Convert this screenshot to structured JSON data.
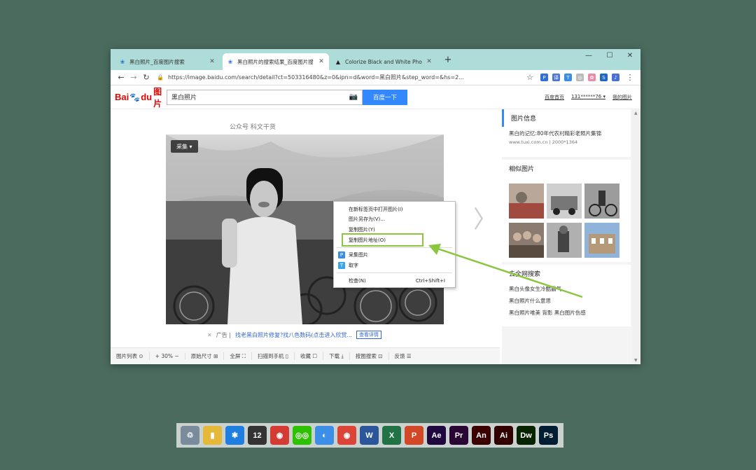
{
  "browser": {
    "tabs": [
      {
        "label": "黑白照片_百度图片搜索",
        "icon": "baidu-paw-icon"
      },
      {
        "label": "黑白照片的搜索结果_百度图片搜",
        "icon": "baidu-paw-icon"
      },
      {
        "label": "Colorize Black and White Pho",
        "icon": "algorithmia-icon"
      }
    ],
    "new_tab": "+",
    "controls": {
      "minimize": "—",
      "maximize": "☐",
      "close": "✕"
    },
    "url": "https://image.baidu.com/search/detail?ct=503316480&z=0&ipn=d&word=黑白照片&step_word=&hs=2...",
    "ext_icons": [
      {
        "name": "pocket-icon",
        "glyph": "P",
        "color": "#2f6fd8"
      },
      {
        "name": "translate-icon",
        "glyph": "译",
        "color": "#4a77d4"
      },
      {
        "name": "t-icon",
        "glyph": "T",
        "color": "#3a8ee6"
      },
      {
        "name": "circle-icon",
        "glyph": "◎",
        "color": "#bbbbbb"
      },
      {
        "name": "pink-icon",
        "glyph": "✿",
        "color": "#e88ca8"
      },
      {
        "name": "s-icon",
        "glyph": "S",
        "color": "#1f66c9"
      },
      {
        "name": "music-icon",
        "glyph": "♪",
        "color": "#4a6fd8"
      }
    ]
  },
  "baidu": {
    "logo": {
      "bai": "Bai",
      "paw": "🐾",
      "du": "du",
      "img": "图片"
    },
    "query": "黑白照片",
    "search_button": "百度一下",
    "header_links": [
      "百度首页",
      "131******76 ▾",
      "我的图片"
    ]
  },
  "detail": {
    "source_caption": "公众号  科文干货",
    "collect_button": "采集 ▾",
    "next_arrow": "〉",
    "ad_close": "✕",
    "ad_label": "广告 |",
    "ad_text": "找老黑白照片修复?找八色数码(点击进入欣赏...",
    "ad_button": "查看详情",
    "bottom_bar": [
      "图片列表 ⊙",
      "+ 30% −",
      "原始尺寸 ⊞",
      "全屏 ⛶",
      "扫描到手机 ▯",
      "收藏 ☐",
      "下载 ⤓",
      "按图搜索 ⊡",
      "反馈 ☰"
    ]
  },
  "context_menu": {
    "items": [
      {
        "label": "在新标签页中打开图片(I)"
      },
      {
        "label": "图片另存为(V)..."
      },
      {
        "label": "复制图片(Y)"
      },
      {
        "label": "复制图片地址(O)"
      },
      {
        "label": "采集图片",
        "icon": "P"
      },
      {
        "label": "取字",
        "icon": "T"
      },
      {
        "label": "检查(N)",
        "shortcut": "Ctrl+Shift+I"
      }
    ]
  },
  "right_panel": {
    "info_title": "图片信息",
    "info_text": "黑白的记忆:80年代农村精彩老照片集锦",
    "info_meta": "www.tuxi.com.cn  |  2000*1364",
    "similar_title": "相似图片",
    "web_search_title": "去全网搜索",
    "web_links": [
      "黑白头像女生冷酷霸气",
      "黑白照片什么意思",
      "黑白照片唯美 背影    黑白图片伤感"
    ]
  },
  "dock": [
    {
      "name": "recycle-bin-icon",
      "label": "♲",
      "color": "#7a8c9c"
    },
    {
      "name": "folder-icon",
      "label": "▮",
      "color": "#e6b83a"
    },
    {
      "name": "thunder-icon",
      "label": "✱",
      "color": "#1e7fe0"
    },
    {
      "name": "calendar-icon",
      "label": "12",
      "color": "#333333"
    },
    {
      "name": "netease-music-icon",
      "label": "◉",
      "color": "#d43c33"
    },
    {
      "name": "wechat-icon",
      "label": "◎◎",
      "color": "#2dc100"
    },
    {
      "name": "finder-icon",
      "label": "◐",
      "color": "#3d8ee6"
    },
    {
      "name": "chrome-icon",
      "label": "◉",
      "color": "#db4437"
    },
    {
      "name": "word-icon",
      "label": "W",
      "color": "#2b579a"
    },
    {
      "name": "excel-icon",
      "label": "X",
      "color": "#217346"
    },
    {
      "name": "powerpoint-icon",
      "label": "P",
      "color": "#d24726"
    },
    {
      "name": "after-effects-icon",
      "label": "Ae",
      "color": "#1f0740"
    },
    {
      "name": "premiere-icon",
      "label": "Pr",
      "color": "#2a0634"
    },
    {
      "name": "animate-icon",
      "label": "An",
      "color": "#3b0000"
    },
    {
      "name": "illustrator-icon",
      "label": "Ai",
      "color": "#330000"
    },
    {
      "name": "dreamweaver-icon",
      "label": "Dw",
      "color": "#072401"
    },
    {
      "name": "photoshop-icon",
      "label": "Ps",
      "color": "#001d34"
    }
  ]
}
